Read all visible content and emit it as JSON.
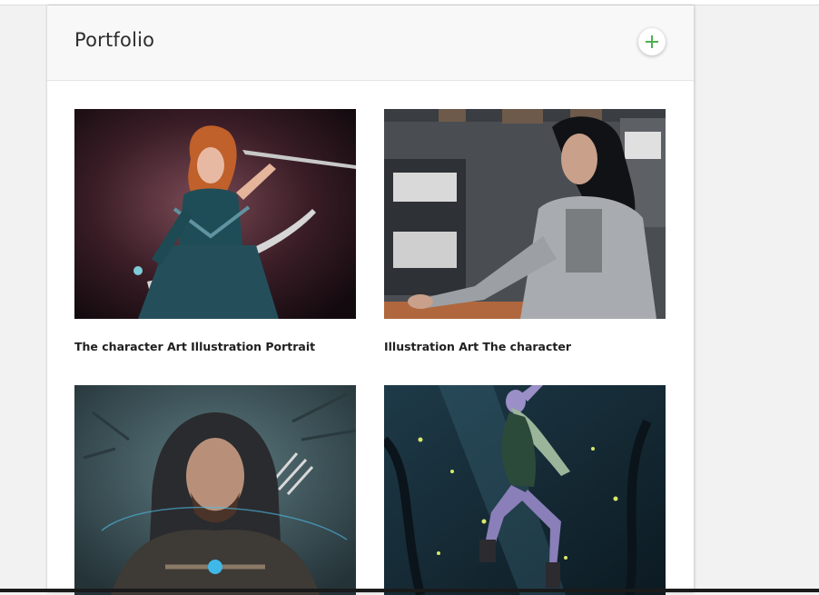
{
  "portfolio": {
    "title": "Portfolio",
    "add_icon": "plus-icon",
    "accent_color": "#4caf50",
    "items": [
      {
        "caption": "The character Art Illustration Portrait",
        "image": "warrior-woman-with-sword"
      },
      {
        "caption": "Illustration Art The character",
        "image": "woman-at-desk"
      },
      {
        "caption": "",
        "image": "hooded-archer"
      },
      {
        "caption": "",
        "image": "forest-elf-dancer"
      }
    ]
  }
}
